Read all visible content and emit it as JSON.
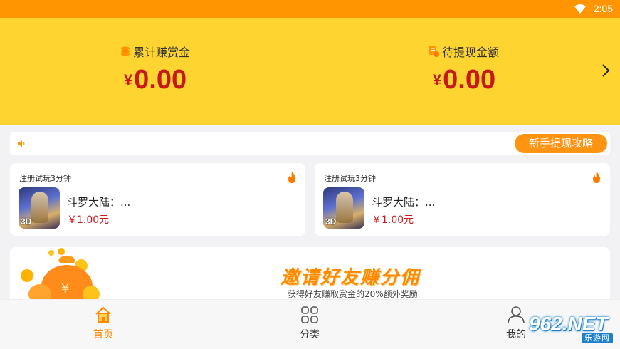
{
  "status_bar": {
    "time": "2:05"
  },
  "header": {
    "earned_label": "累计赚赏金",
    "earned_currency": "¥",
    "earned_value": "0.00",
    "pending_label": "待提现金额",
    "pending_currency": "¥",
    "pending_value": "0.00"
  },
  "notice": {
    "guide_button": "新手提现攻略"
  },
  "tasks": [
    {
      "tag": "注册试玩3分钟",
      "title": "斗罗大陆：...",
      "badge": "3D",
      "reward": "￥1.00元"
    },
    {
      "tag": "注册试玩3分钟",
      "title": "斗罗大陆：...",
      "badge": "3D",
      "reward": "￥1.00元"
    }
  ],
  "invite": {
    "title": "邀请好友赚分佣",
    "subtitle": "获得好友赚取赏金的20%额外奖励"
  },
  "tabbar": {
    "items": [
      {
        "label": "首页",
        "active": true
      },
      {
        "label": "分类",
        "active": false
      },
      {
        "label": "我的",
        "active": false
      }
    ]
  },
  "watermark": {
    "logo": "962.NET",
    "sub": "乐游网"
  },
  "colors": {
    "status_bar": "#ff9500",
    "header": "#fed530",
    "accent": "#ff8a00",
    "value_red": "#c8191a"
  },
  "icons": [
    "wifi-icon",
    "coin-stack-icon",
    "document-coin-icon",
    "chevron-right-icon",
    "speaker-icon",
    "fire-icon",
    "home-icon",
    "grid-icon",
    "user-icon",
    "money-bag-icon"
  ]
}
